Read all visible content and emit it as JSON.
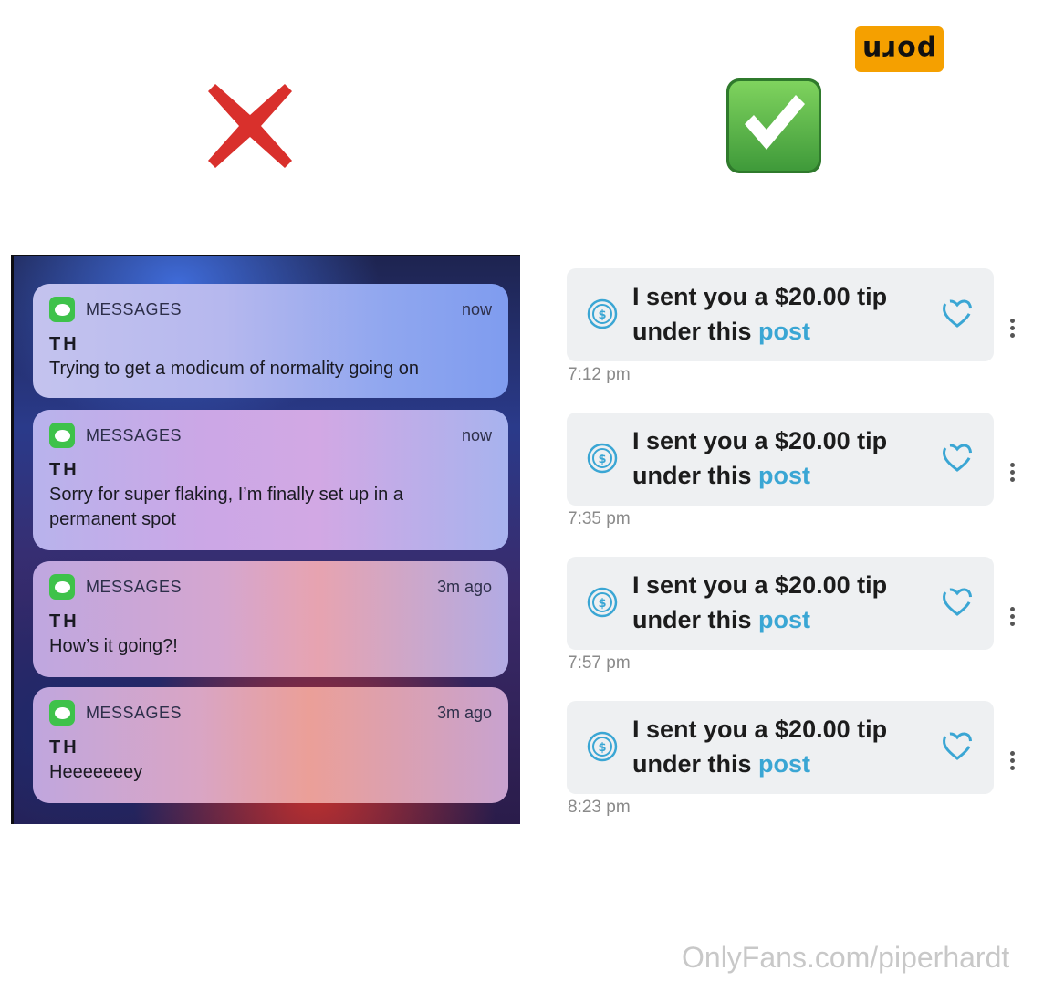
{
  "watermark": {
    "text": "porn"
  },
  "colors": {
    "wrong": "#d9302c",
    "right": "#5ab84a",
    "tip_link": "#3aa6d4",
    "badge": "#f5a000"
  },
  "icons": {
    "wrong": "red-x-icon",
    "right": "green-check-icon",
    "app": "messages-app-icon",
    "tip": "dollar-coin-icon",
    "like": "heart-icon",
    "more": "kebab-menu-icon"
  },
  "notifications": [
    {
      "app": "MESSAGES",
      "time": "now",
      "sender": "TH",
      "body": "Trying to get a modicum of normality going on"
    },
    {
      "app": "MESSAGES",
      "time": "now",
      "sender": "TH",
      "body": "Sorry for super flaking, I’m finally set up in a permanent spot"
    },
    {
      "app": "MESSAGES",
      "time": "3m ago",
      "sender": "TH",
      "body": "How’s it going?!"
    },
    {
      "app": "MESSAGES",
      "time": "3m ago",
      "sender": "TH",
      "body": "Heeeeeeey"
    }
  ],
  "tips": [
    {
      "line1": "I sent you a $20.00 tip",
      "line2": "under this",
      "link": "post",
      "time": "7:12 pm"
    },
    {
      "line1": "I sent you a $20.00 tip",
      "line2": "under this",
      "link": "post",
      "time": "7:35 pm"
    },
    {
      "line1": "I sent you a $20.00 tip",
      "line2": "under this",
      "link": "post",
      "time": "7:57 pm"
    },
    {
      "line1": "I sent you a $20.00 tip",
      "line2": "under this",
      "link": "post",
      "time": "8:23 pm"
    }
  ],
  "footer": {
    "text": "OnlyFans.com/piperhardt"
  }
}
